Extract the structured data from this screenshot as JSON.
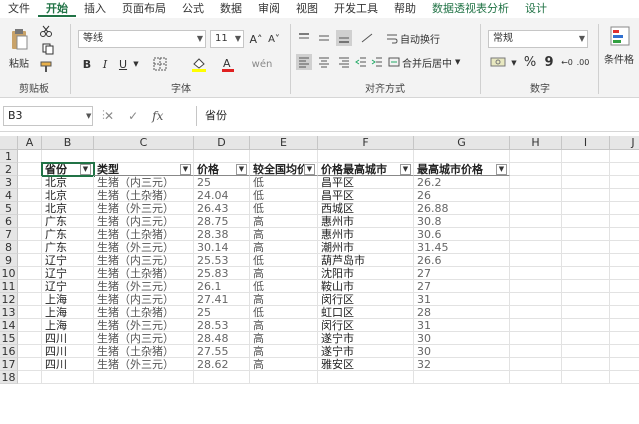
{
  "tabs": [
    "文件",
    "开始",
    "插入",
    "页面布局",
    "公式",
    "数据",
    "审阅",
    "视图",
    "开发工具",
    "帮助",
    "数据透视表分析",
    "设计"
  ],
  "active_tab": "开始",
  "ribbon": {
    "clipboard": {
      "label": "剪贴板",
      "paste": "粘贴"
    },
    "font": {
      "label": "字体",
      "family": "等线",
      "size": "11",
      "grow": "A˄",
      "shrink": "A˅",
      "bold": "B",
      "italic": "I",
      "underline": "U"
    },
    "alignment": {
      "label": "对齐方式",
      "wrap": "自动换行",
      "merge": "合并后居中"
    },
    "number": {
      "label": "数字",
      "format": "常规",
      "percent": "%",
      "comma": "9"
    },
    "styles": {
      "conditional": "条件格"
    }
  },
  "formula_bar": {
    "name_box": "B3",
    "cancel": "✕",
    "enter": "✓",
    "fx": "fx",
    "content": "省份"
  },
  "columns": [
    "A",
    "B",
    "C",
    "D",
    "E",
    "F",
    "G",
    "H",
    "I",
    "J"
  ],
  "rows": [
    "1",
    "2",
    "3",
    "4",
    "5",
    "6",
    "7",
    "8",
    "9",
    "10",
    "11",
    "12",
    "13",
    "14",
    "15",
    "16",
    "17",
    "18"
  ],
  "table": {
    "headers": [
      "省份",
      "类型",
      "价格",
      "较全国均价",
      "价格最高城市",
      "最高城市价格"
    ],
    "rows": [
      [
        "北京",
        "生猪（内三元）",
        "25",
        "低",
        "昌平区",
        "26.2"
      ],
      [
        "北京",
        "生猪（土杂猪）",
        "24.04",
        "低",
        "昌平区",
        "26"
      ],
      [
        "北京",
        "生猪（外三元）",
        "26.43",
        "低",
        "西城区",
        "26.88"
      ],
      [
        "广东",
        "生猪（内三元）",
        "28.75",
        "高",
        "惠州市",
        "30.8"
      ],
      [
        "广东",
        "生猪（土杂猪）",
        "28.38",
        "高",
        "惠州市",
        "30.6"
      ],
      [
        "广东",
        "生猪（外三元）",
        "30.14",
        "高",
        "潮州市",
        "31.45"
      ],
      [
        "辽宁",
        "生猪（内三元）",
        "25.53",
        "低",
        "葫芦岛市",
        "26.6"
      ],
      [
        "辽宁",
        "生猪（土杂猪）",
        "25.83",
        "高",
        "沈阳市",
        "27"
      ],
      [
        "辽宁",
        "生猪（外三元）",
        "26.1",
        "低",
        "鞍山市",
        "27"
      ],
      [
        "上海",
        "生猪（内三元）",
        "27.41",
        "高",
        "闵行区",
        "31"
      ],
      [
        "上海",
        "生猪（土杂猪）",
        "25",
        "低",
        "虹口区",
        "28"
      ],
      [
        "上海",
        "生猪（外三元）",
        "28.53",
        "高",
        "闵行区",
        "31"
      ],
      [
        "四川",
        "生猪（内三元）",
        "28.48",
        "高",
        "遂宁市",
        "30"
      ],
      [
        "四川",
        "生猪（土杂猪）",
        "27.55",
        "高",
        "遂宁市",
        "30"
      ],
      [
        "四川",
        "生猪（外三元）",
        "28.62",
        "高",
        "雅安区",
        "32"
      ]
    ]
  },
  "colors": {
    "accent": "#217346",
    "header_bg": "#e6e6e6",
    "ribbon_bg": "#f3f3f3"
  }
}
